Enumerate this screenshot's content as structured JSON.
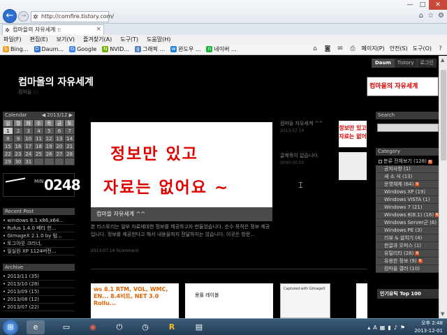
{
  "browser": {
    "url": "http://comfire.tistory.com/",
    "tab_title": "컴마을의 자유세계 ::",
    "menu": [
      "파일(F)",
      "편집(E)",
      "보기(V)",
      "즐겨찾기(A)",
      "도구(T)",
      "도움말(H)"
    ],
    "favorites": [
      {
        "label": "Bing...",
        "icon": "bing-icon",
        "color": "#f0a020"
      },
      {
        "label": "Daum...",
        "icon": "daum-icon",
        "color": "#3070d0"
      },
      {
        "label": "Google",
        "icon": "google-icon",
        "color": "#3d80f0"
      },
      {
        "label": "NVID...",
        "icon": "nvidia-icon",
        "color": "#70b000"
      },
      {
        "label": "그래픽 ...",
        "icon": "graphic-icon",
        "color": "#5080c0"
      },
      {
        "label": "윈도우 ...",
        "icon": "windows-icon",
        "color": "#2080e0"
      },
      {
        "label": "네이버 ...",
        "icon": "naver-icon",
        "color": "#20b040"
      }
    ],
    "commands": [
      "페이지(P)",
      "안전(S)",
      "도구(O)"
    ]
  },
  "site": {
    "title": "컴마을의 자유세계",
    "subtitle": "컴마을 :::",
    "top_links": [
      "Daum",
      "Tistory",
      "로그인"
    ],
    "banner": "컴마을의 자유세계"
  },
  "calendar": {
    "label": "Calendar",
    "month": "◀ 2013/12 ▶",
    "dow": [
      "일",
      "월",
      "화",
      "수",
      "목",
      "금",
      "토"
    ],
    "days": [
      "1",
      "2",
      "3",
      "4",
      "5",
      "6",
      "7",
      "8",
      "9",
      "10",
      "11",
      "12",
      "13",
      "14",
      "15",
      "16",
      "17",
      "18",
      "19",
      "20",
      "21",
      "22",
      "23",
      "24",
      "25",
      "26",
      "27",
      "28",
      "29",
      "30",
      "31",
      "",
      "",
      "",
      ""
    ]
  },
  "clock": {
    "minute_label": "MIN",
    "time": "0248"
  },
  "recent_post": {
    "heading": "Recent Post",
    "items": [
      "windows 8.1 x86,x64...",
      "Rufus 1.4.0 베타 한...",
      "GImageX 2.1.0 by 텀...",
      "토그아웃 크리너,",
      "일실원 XP 1124버전..."
    ]
  },
  "archive": {
    "heading": "Archive",
    "items": [
      "2013/11 (35)",
      "2013/10 (28)",
      "2013/09 (15)",
      "2013/08 (12)",
      "2013/07 (22)"
    ]
  },
  "featured": {
    "line1": "정보만 있고",
    "line2": "자료는 없어요 ~",
    "caption": "컴마을 자유세계 ^^",
    "text": "본 티스토리는 일부 자료에대한 정보를 제공하고자 만들었습니다. 순수 목적은 정보 제공입니다. 정보를 제공한다고 해서 내용을까지 전달하지는 않습니다. 이곳은 방문...",
    "meta": "2013.07.14   0comment"
  },
  "side_posts": [
    {
      "title": "컴마을 자유세계 ^^",
      "meta": "2013.07.14"
    },
    {
      "title": "글제목이 없습니다.",
      "meta": "0000.00.00"
    }
  ],
  "thumb_small": "정보만 있고 자료는 없어",
  "bottom_thumbs": {
    "t1": "ws 8.1 RTM, VOL, WMC, EN... 8.4비트, NET 3.0 Rollu...",
    "t2": "용률 레이블",
    "t3": "Captured with GImageX"
  },
  "search": {
    "heading": "Search"
  },
  "category": {
    "heading": "Category",
    "items": [
      {
        "label": "분류 전체보기 (128)",
        "level": "top",
        "new": true
      },
      {
        "label": "공지사항 (1)",
        "level": "sub",
        "new": false
      },
      {
        "label": "새 소 식 (13)",
        "level": "sub",
        "new": false
      },
      {
        "label": "운영체제 (64)",
        "level": "sub",
        "new": true
      },
      {
        "label": "Windows XP (19)",
        "level": "sub",
        "new": false
      },
      {
        "label": "Windows VISTA (1)",
        "level": "sub",
        "new": false
      },
      {
        "label": "Windows 7 (21)",
        "level": "sub",
        "new": false
      },
      {
        "label": "Windows 8(8.1) (16)",
        "level": "sub",
        "new": true
      },
      {
        "label": "Windows Server군 (6)",
        "level": "sub",
        "new": false
      },
      {
        "label": "Windows PE (3)",
        "level": "sub",
        "new": false
      },
      {
        "label": "리뷰 & 설치기 (4)",
        "level": "sub",
        "new": false
      },
      {
        "label": "한글과 오피스 (1)",
        "level": "sub",
        "new": false
      },
      {
        "label": "유틸리티 (28)",
        "level": "sub",
        "new": true
      },
      {
        "label": "유용한 정보 (9)",
        "level": "sub",
        "new": true
      },
      {
        "label": "컴마을 갤러 (10)",
        "level": "sub",
        "new": false
      }
    ]
  },
  "popular": {
    "heading": "인기유틱 Top 100"
  },
  "taskbar": {
    "clock_time": "오후 2:48",
    "clock_date": "2013-12-01"
  }
}
